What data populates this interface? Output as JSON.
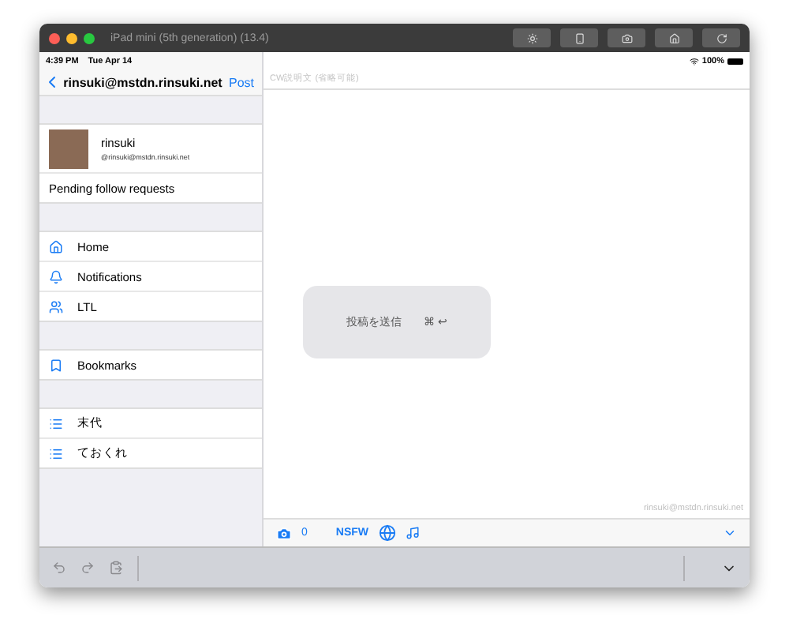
{
  "simulator": {
    "title": "iPad mini (5th generation) (13.4)"
  },
  "status_bar": {
    "time": "4:39 PM",
    "date": "Tue Apr 14",
    "battery": "100%"
  },
  "nav": {
    "title": "rinsuki@mstdn.rinsuki.net",
    "action": "Post"
  },
  "profile": {
    "name": "rinsuki",
    "handle": "@rinsuki@mstdn.rinsuki.net"
  },
  "pending": "Pending follow requests",
  "sections": [
    [
      {
        "kind": "home",
        "label": "Home"
      },
      {
        "kind": "bell",
        "label": "Notifications"
      },
      {
        "kind": "people",
        "label": "LTL"
      }
    ],
    [
      {
        "kind": "bookmark",
        "label": "Bookmarks"
      }
    ],
    [
      {
        "kind": "list",
        "label": "末代"
      },
      {
        "kind": "list",
        "label": "ておくれ"
      }
    ]
  ],
  "compose": {
    "cw_placeholder": "CW説明文 (省略可能)",
    "account": "rinsuki@mstdn.rinsuki.net",
    "image_count": "0",
    "nsfw": "NSFW"
  },
  "shortcut_hint": {
    "label": "投稿を送信",
    "command": "⌘",
    "enter": "↩"
  }
}
